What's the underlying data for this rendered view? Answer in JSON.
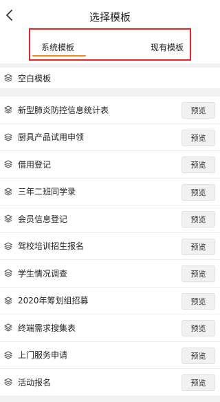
{
  "nav": {
    "title": "选择模板",
    "back_icon": "chevron-left-icon"
  },
  "tabs": [
    {
      "label": "系统模板",
      "active": true
    },
    {
      "label": "现有模板",
      "active": false
    }
  ],
  "colors": {
    "accent": "#f08a1e",
    "highlight_border": "#e8242a",
    "background": "#f2f2f2"
  },
  "blank_template": {
    "label": "空白模板",
    "icon": "layers-icon"
  },
  "templates": [
    {
      "label": "新型肺炎防控信息统计表",
      "button": "预览"
    },
    {
      "label": "厨具产品试用申领",
      "button": "预览"
    },
    {
      "label": "借用登记",
      "button": "预览"
    },
    {
      "label": "三年二班同学录",
      "button": "预览"
    },
    {
      "label": "会员信息登记",
      "button": "预览"
    },
    {
      "label": "驾校培训招生报名",
      "button": "预览"
    },
    {
      "label": "学生情况调查",
      "button": "预览"
    },
    {
      "label": "2020年筹划组招募",
      "button": "预览"
    },
    {
      "label": "终端需求搜集表",
      "button": "预览"
    },
    {
      "label": "上门服务申请",
      "button": "预览"
    },
    {
      "label": "活动报名",
      "button": "预览"
    }
  ]
}
